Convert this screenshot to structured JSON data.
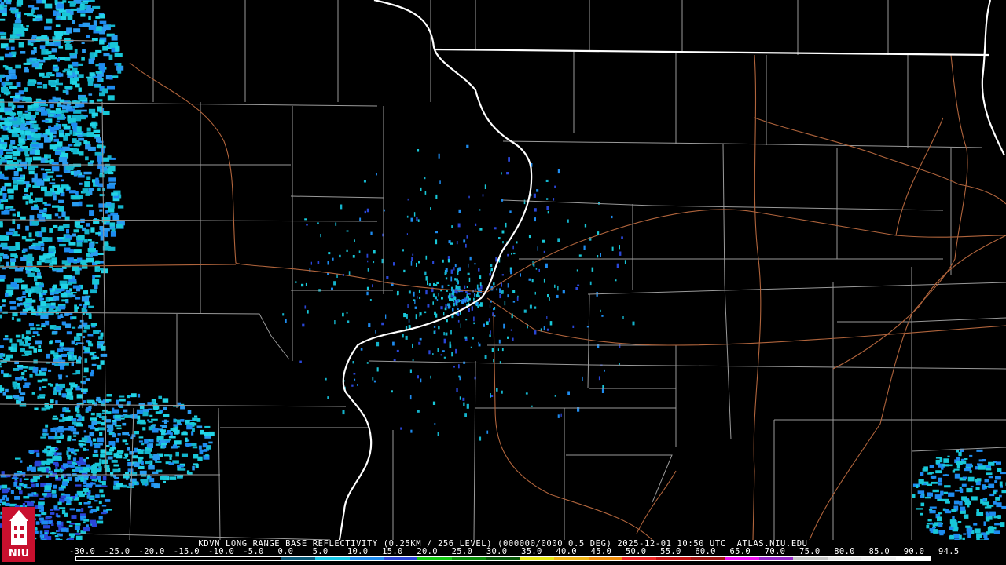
{
  "map": {
    "radar": "KDVN",
    "features": [
      "state-borders",
      "county-borders",
      "interstate-highways",
      "radar-echoes"
    ],
    "colors": {
      "background": "#000000",
      "state_border": "#ffffff",
      "county_border": "#9a9a9a",
      "highway": "#b0643c",
      "echo_light": "#18c8d8",
      "echo_medium": "#1e8cf0",
      "echo_dark": "#2a46d8"
    }
  },
  "caption": "KDVN LONG RANGE BASE REFLECTIVITY (0.25KM / 256 LEVEL) (000000/0000 0.5 DEG) 2025-12-01 10:50 UTC  ATLAS.NIU.EDU",
  "scale": {
    "labels": [
      "-30.0",
      "-25.0",
      "-20.0",
      "-15.0",
      "-10.0",
      "-5.0",
      "0.0",
      "5.0",
      "10.0",
      "15.0",
      "20.0",
      "25.0",
      "30.0",
      "35.0",
      "40.0",
      "45.0",
      "50.0",
      "55.0",
      "60.0",
      "65.0",
      "70.0",
      "75.0",
      "80.0",
      "85.0",
      "90.0",
      "94.5"
    ],
    "colors": [
      "#000000",
      "#000000",
      "#000000",
      "#000000",
      "#000000",
      "#000000",
      "#0a5a78",
      "#18c8e8",
      "#1e8cf0",
      "#2a46d8",
      "#14c814",
      "#0a8c0a",
      "#0a5a0a",
      "#e6e614",
      "#f0b414",
      "#f08c0a",
      "#f02828",
      "#c81414",
      "#a01414",
      "#f014f0",
      "#9628c8",
      "#c8c8c8",
      "#e6e6e6",
      "#f0f0f0",
      "#ffffff"
    ]
  },
  "logo": {
    "text": "NIU",
    "color": "#c8102e"
  }
}
